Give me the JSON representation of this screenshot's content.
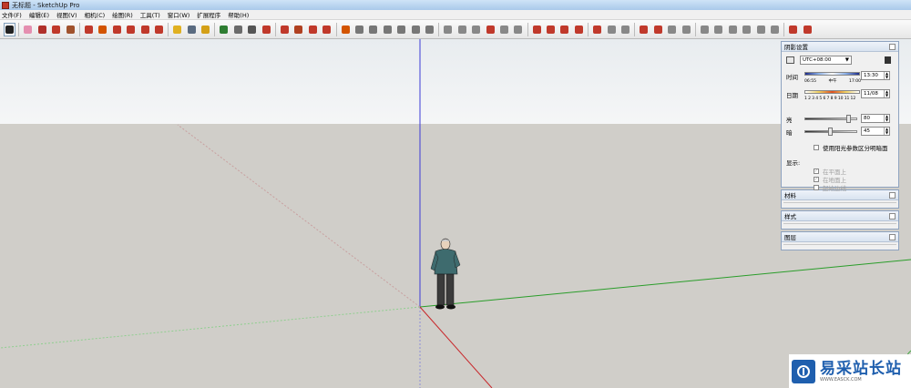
{
  "window": {
    "title": "无标题 - SketchUp Pro"
  },
  "menu": [
    "文件(F)",
    "编辑(E)",
    "视图(V)",
    "相机(C)",
    "绘图(R)",
    "工具(T)",
    "窗口(W)",
    "扩展程序",
    "帮助(H)"
  ],
  "toolbar": {
    "icons": [
      {
        "name": "select-icon",
        "color": "#222222"
      },
      {
        "name": "eraser-icon",
        "color": "#e58fb0"
      },
      {
        "name": "pencil-icon",
        "color": "#b0302a"
      },
      {
        "name": "arc-icon",
        "color": "#c0392b"
      },
      {
        "name": "shape-icon",
        "color": "#a0522d"
      },
      {
        "name": "push-pull-icon",
        "color": "#c0392b"
      },
      {
        "name": "follow-me-icon",
        "color": "#d35400"
      },
      {
        "name": "move-icon",
        "color": "#c0392b"
      },
      {
        "name": "rotate-icon",
        "color": "#c0392b"
      },
      {
        "name": "scale-icon",
        "color": "#c0392b"
      },
      {
        "name": "offset-icon",
        "color": "#c0392b"
      },
      {
        "name": "tape-measure-icon",
        "color": "#e0b020"
      },
      {
        "name": "text-icon",
        "color": "#5a6b80"
      },
      {
        "name": "paint-bucket-icon",
        "color": "#d4a017"
      },
      {
        "name": "orbit-icon",
        "color": "#2e7d32"
      },
      {
        "name": "pan-icon",
        "color": "#6b6b6b"
      },
      {
        "name": "zoom-icon",
        "color": "#555555"
      },
      {
        "name": "zoom-extents-icon",
        "color": "#c0392b"
      },
      {
        "name": "warehouse-icon",
        "color": "#c0392b"
      },
      {
        "name": "extension-icon",
        "color": "#b04020"
      },
      {
        "name": "layout-icon",
        "color": "#c0392b"
      },
      {
        "name": "sandbox-icon",
        "color": "#c0392b"
      },
      {
        "name": "section-icon",
        "color": "#d35400"
      },
      {
        "name": "iso-view-icon",
        "color": "#777777"
      },
      {
        "name": "top-view-icon",
        "color": "#777777"
      },
      {
        "name": "front-view-icon",
        "color": "#777777"
      },
      {
        "name": "right-view-icon",
        "color": "#777777"
      },
      {
        "name": "back-view-icon",
        "color": "#777777"
      },
      {
        "name": "left-view-icon",
        "color": "#777777"
      },
      {
        "name": "xray-icon",
        "color": "#888888"
      },
      {
        "name": "wireframe-icon",
        "color": "#888888"
      },
      {
        "name": "hidden-line-icon",
        "color": "#888888"
      },
      {
        "name": "shaded-icon",
        "color": "#c0392b"
      },
      {
        "name": "textured-icon",
        "color": "#888888"
      },
      {
        "name": "monochrome-icon",
        "color": "#888888"
      },
      {
        "name": "walk-icon",
        "color": "#c0392b"
      },
      {
        "name": "look-around-icon",
        "color": "#c0392b"
      },
      {
        "name": "position-camera-icon",
        "color": "#c0392b"
      },
      {
        "name": "axes-icon",
        "color": "#c0392b"
      },
      {
        "name": "dimension-icon",
        "color": "#c0392b"
      },
      {
        "name": "protractor-icon",
        "color": "#888888"
      },
      {
        "name": "3d-text-icon",
        "color": "#888888"
      },
      {
        "name": "stamp-icon",
        "color": "#c0392b"
      },
      {
        "name": "component-icon",
        "color": "#c0392b"
      },
      {
        "name": "group-icon",
        "color": "#888888"
      },
      {
        "name": "solid-union-icon",
        "color": "#888888"
      },
      {
        "name": "solid-subtract-icon",
        "color": "#888888"
      },
      {
        "name": "solid-trim-icon",
        "color": "#888888"
      },
      {
        "name": "intersect-icon",
        "color": "#888888"
      },
      {
        "name": "outer-shell-icon",
        "color": "#888888"
      },
      {
        "name": "split-icon",
        "color": "#888888"
      },
      {
        "name": "fog-icon",
        "color": "#888888"
      },
      {
        "name": "shadows-icon",
        "color": "#c0392b"
      },
      {
        "name": "add-location-icon",
        "color": "#c0392b"
      }
    ]
  },
  "shadow_panel": {
    "title": "阴影设置",
    "timezone": "UTC+08:00",
    "time_label": "时间",
    "time_start": "06:55",
    "time_mid": "中午",
    "time_end": "17:00",
    "time_value": "13:30",
    "date_label": "日期",
    "months": "1 2 3 4 5 6 7 8 9 10 11 12",
    "date_value": "11/08",
    "light_label": "亮",
    "light_value": "80",
    "dark_label": "暗",
    "dark_value": "45",
    "sun_shading": "使用阳光参数区分明暗面",
    "display_label": "显示:",
    "on_faces": "在平面上",
    "on_ground": "在地面上",
    "from_edges": "起始边线"
  },
  "panels": [
    {
      "title": "材料"
    },
    {
      "title": "样式"
    },
    {
      "title": "图层"
    }
  ],
  "watermark": {
    "name": "易采站长站",
    "url": "WWW.EASCK.COM"
  }
}
